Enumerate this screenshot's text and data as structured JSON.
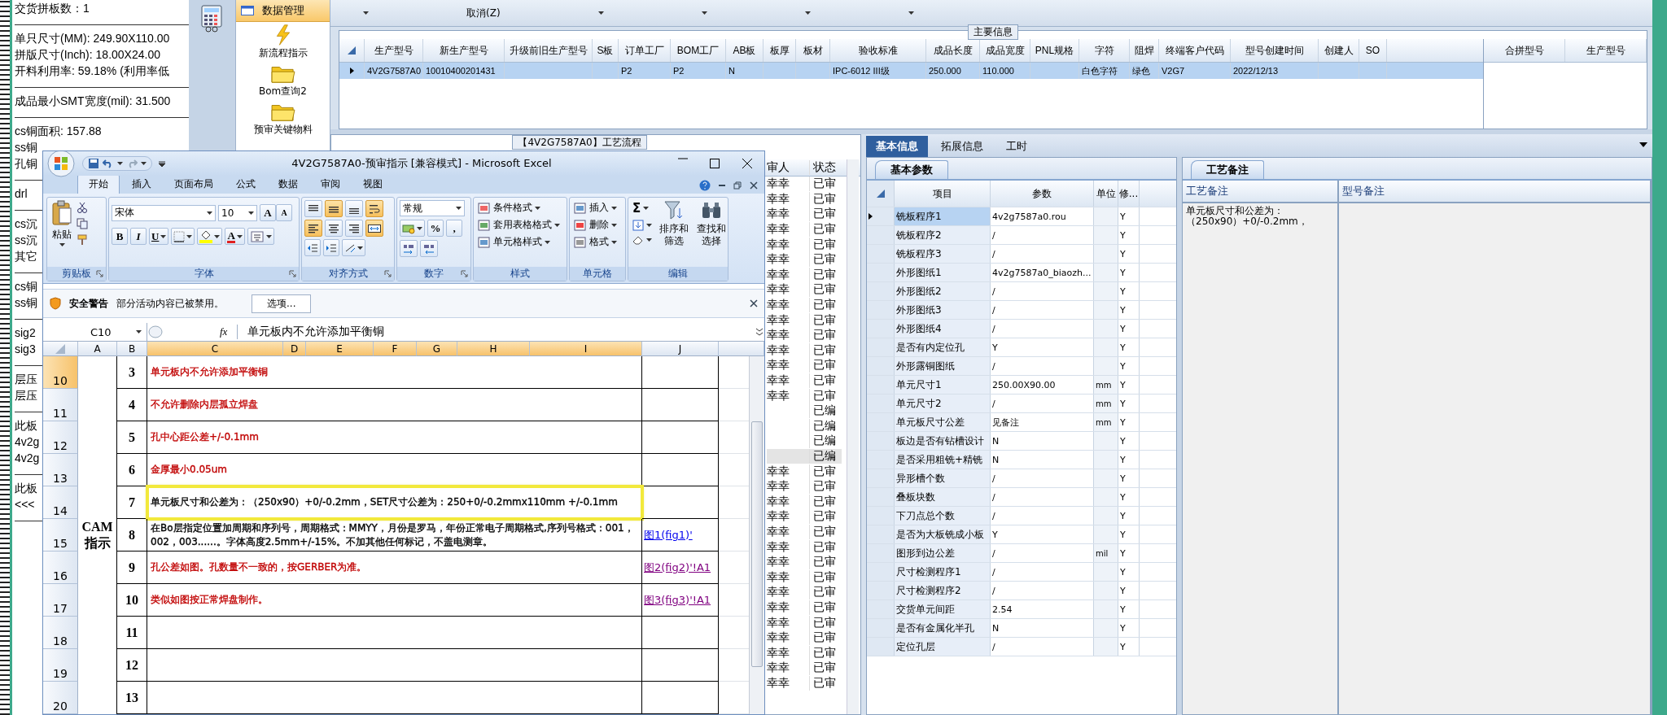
{
  "report_window": {
    "sections": [
      [
        "交货拼板数：1"
      ],
      [
        "单只尺寸(MM): 249.90X110.00",
        "拼版尺寸(Inch): 18.00X24.00",
        "开料利用率: 59.18% (利用率低"
      ],
      [
        "成品最小SMT宽度(mil): 31.500"
      ],
      [
        "cs铜面积: 157.88",
        "ss铜",
        "孔铜"
      ],
      [
        "drl"
      ],
      [
        "cs沉",
        "ss沉",
        "其它"
      ],
      [
        "cs铜",
        "ss铜"
      ],
      [
        "sig2",
        "sig3"
      ],
      [
        "层压",
        "层压"
      ],
      [
        "此板",
        "4v2g",
        "4v2g"
      ],
      [
        "此板",
        "<<<"
      ]
    ]
  },
  "app": {
    "nav": {
      "header": "数据管理",
      "items": [
        {
          "label": "新流程指示",
          "kind": "lightning"
        },
        {
          "label": "Bom查询2",
          "kind": "folder"
        },
        {
          "label": "预审关键物料",
          "kind": "folder"
        }
      ]
    },
    "toolbar": {
      "cancel": "取消(Z)"
    },
    "main_info": {
      "title": "主要信息",
      "columns": [
        "生产型号",
        "新生产型号",
        "升级前旧生产型号",
        "S板",
        "订单工厂",
        "BOM工厂",
        "AB板",
        "板厚",
        "板材",
        "验收标准",
        "成品长度",
        "成品宽度",
        "PNL规格",
        "字符",
        "阻焊",
        "终端客户代码",
        "型号创建时间",
        "创建人",
        "SO"
      ],
      "rows": [
        {
          "selected": true,
          "cells": [
            "4V2G7587A0",
            "10010400201431",
            null,
            null,
            "P2",
            "P2",
            "N",
            null,
            null,
            "IPC-6012 III级",
            "250.000",
            "110.000",
            null,
            "白色字符",
            "绿色",
            "V2G7",
            "2022/12/13",
            null,
            null
          ]
        }
      ],
      "merge_columns": [
        "合拼型号",
        "生产型号"
      ]
    },
    "flow_panel": {
      "title": "【4V2G7587A0】工艺流程",
      "columns": [
        "审人",
        "状态"
      ],
      "rows": [
        {
          "reviewer": "幸幸",
          "status": "已审",
          "selected": false
        },
        {
          "reviewer": "幸幸",
          "status": "已审",
          "selected": false
        },
        {
          "reviewer": "幸幸",
          "status": "已审",
          "selected": false
        },
        {
          "reviewer": "幸幸",
          "status": "已审",
          "selected": false
        },
        {
          "reviewer": "幸幸",
          "status": "已审",
          "selected": false
        },
        {
          "reviewer": "幸幸",
          "status": "已审",
          "selected": false
        },
        {
          "reviewer": "幸幸",
          "status": "已审",
          "selected": false
        },
        {
          "reviewer": "幸幸",
          "status": "已审",
          "selected": false
        },
        {
          "reviewer": "幸幸",
          "status": "已审",
          "selected": false
        },
        {
          "reviewer": "幸幸",
          "status": "已审",
          "selected": false
        },
        {
          "reviewer": "幸幸",
          "status": "已审",
          "selected": false
        },
        {
          "reviewer": "幸幸",
          "status": "已审",
          "selected": false
        },
        {
          "reviewer": "幸幸",
          "status": "已审",
          "selected": false
        },
        {
          "reviewer": "幸幸",
          "status": "已审",
          "selected": false
        },
        {
          "reviewer": "幸幸",
          "status": "已审",
          "selected": false
        },
        {
          "reviewer": null,
          "status": "已编",
          "selected": false
        },
        {
          "reviewer": null,
          "status": "已编",
          "selected": false
        },
        {
          "reviewer": null,
          "status": "已编",
          "selected": false
        },
        {
          "reviewer": null,
          "status": "已编",
          "selected": true
        },
        {
          "reviewer": "幸幸",
          "status": "已审",
          "selected": false
        },
        {
          "reviewer": "幸幸",
          "status": "已审",
          "selected": false
        },
        {
          "reviewer": "幸幸",
          "status": "已审",
          "selected": false
        },
        {
          "reviewer": "幸幸",
          "status": "已审",
          "selected": false
        },
        {
          "reviewer": "幸幸",
          "status": "已审",
          "selected": false
        },
        {
          "reviewer": "幸幸",
          "status": "已审",
          "selected": false
        },
        {
          "reviewer": "幸幸",
          "status": "已审",
          "selected": false
        },
        {
          "reviewer": "幸幸",
          "status": "已审",
          "selected": false
        },
        {
          "reviewer": "幸幸",
          "status": "已审",
          "selected": false
        },
        {
          "reviewer": "幸幸",
          "status": "已审",
          "selected": false
        },
        {
          "reviewer": "幸幸",
          "status": "已审",
          "selected": false
        },
        {
          "reviewer": "幸幸",
          "status": "已审",
          "selected": false
        },
        {
          "reviewer": "幸幸",
          "status": "已审",
          "selected": false
        },
        {
          "reviewer": "幸幸",
          "status": "已审",
          "selected": false
        },
        {
          "reviewer": "幸幸",
          "status": "已审",
          "selected": false
        }
      ]
    },
    "detail_tabs": [
      {
        "label": "基本信息",
        "selected": true
      },
      {
        "label": "拓展信息",
        "selected": false
      },
      {
        "label": "工时",
        "selected": false
      }
    ],
    "params": {
      "tab": "基本参数",
      "columns": [
        "项目",
        "参数",
        "单位",
        "修..."
      ],
      "rows": [
        {
          "item": "铣板程序1",
          "value": "4v2g7587a0.rou",
          "unit": null,
          "flag": "Y",
          "selected": true
        },
        {
          "item": "铣板程序2",
          "value": "/",
          "unit": null,
          "flag": "Y",
          "selected": false
        },
        {
          "item": "铣板程序3",
          "value": "/",
          "unit": null,
          "flag": "Y",
          "selected": false
        },
        {
          "item": "外形图纸1",
          "value": "4v2g7587a0_biaozh...",
          "unit": null,
          "flag": "Y",
          "selected": false
        },
        {
          "item": "外形图纸2",
          "value": "/",
          "unit": null,
          "flag": "Y",
          "selected": false
        },
        {
          "item": "外形图纸3",
          "value": "/",
          "unit": null,
          "flag": "Y",
          "selected": false
        },
        {
          "item": "外形图纸4",
          "value": "/",
          "unit": null,
          "flag": "Y",
          "selected": false
        },
        {
          "item": "是否有内定位孔",
          "value": "Y",
          "unit": null,
          "flag": "Y",
          "selected": false
        },
        {
          "item": "外形露铜图纸",
          "value": "/",
          "unit": null,
          "flag": "Y",
          "selected": false
        },
        {
          "item": "单元尺寸1",
          "value": "250.00X90.00",
          "unit": "mm",
          "flag": "Y",
          "selected": false
        },
        {
          "item": "单元尺寸2",
          "value": "/",
          "unit": "mm",
          "flag": "Y",
          "selected": false
        },
        {
          "item": "单元板尺寸公差",
          "value": "见备注",
          "unit": "mm",
          "flag": "Y",
          "selected": false
        },
        {
          "item": "板边是否有钻槽设计",
          "value": "N",
          "unit": null,
          "flag": "Y",
          "selected": false
        },
        {
          "item": "是否采用粗铣+精铣",
          "value": "N",
          "unit": null,
          "flag": "Y",
          "selected": false
        },
        {
          "item": "异形槽个数",
          "value": "/",
          "unit": null,
          "flag": "Y",
          "selected": false
        },
        {
          "item": "叠板块数",
          "value": "/",
          "unit": null,
          "flag": "Y",
          "selected": false
        },
        {
          "item": "下刀点总个数",
          "value": "/",
          "unit": null,
          "flag": "Y",
          "selected": false
        },
        {
          "item": "是否为大板铣成小板",
          "value": "Y",
          "unit": null,
          "flag": "Y",
          "selected": false
        },
        {
          "item": "图形到边公差",
          "value": "/",
          "unit": "mil",
          "flag": "Y",
          "selected": false
        },
        {
          "item": "尺寸检测程序1",
          "value": "/",
          "unit": null,
          "flag": "Y",
          "selected": false
        },
        {
          "item": "尺寸检测程序2",
          "value": "/",
          "unit": null,
          "flag": "Y",
          "selected": false
        },
        {
          "item": "交货单元间距",
          "value": "2.54",
          "unit": null,
          "flag": "Y",
          "selected": false
        },
        {
          "item": "是否有金属化半孔",
          "value": "N",
          "unit": null,
          "flag": "Y",
          "selected": false
        },
        {
          "item": "定位孔层",
          "value": "/",
          "unit": null,
          "flag": "Y",
          "selected": false
        }
      ]
    },
    "remarks": {
      "tab": "工艺备注",
      "columns": [
        "工艺备注",
        "型号备注"
      ],
      "process_note": "单元板尺寸和公差为：（250x90）+0/-0.2mm，"
    }
  },
  "excel": {
    "title": "4V2G7587A0-预审指示  [兼容模式] - Microsoft Excel",
    "tabs": [
      {
        "label": "开始",
        "selected": true
      },
      {
        "label": "插入",
        "selected": false
      },
      {
        "label": "页面布局",
        "selected": false
      },
      {
        "label": "公式",
        "selected": false
      },
      {
        "label": "数据",
        "selected": false
      },
      {
        "label": "审阅",
        "selected": false
      },
      {
        "label": "视图",
        "selected": false
      }
    ],
    "ribbon": {
      "clipboard": {
        "paste": "粘贴",
        "label": "剪贴板"
      },
      "font": {
        "name": "宋体",
        "size": "10",
        "grow": "A",
        "shrink": "A",
        "bold": "B",
        "italic": "I",
        "underline": "U",
        "color_letter": "A",
        "label": "字体"
      },
      "alignment": {
        "buttons": [
          {
            "kind": "top",
            "on": false
          },
          {
            "kind": "middle",
            "on": true
          },
          {
            "kind": "bottom",
            "on": false
          },
          {
            "kind": "wrap",
            "on": true
          },
          {
            "kind": "left",
            "on": true
          },
          {
            "kind": "center",
            "on": false
          },
          {
            "kind": "right",
            "on": false
          },
          {
            "kind": "merge",
            "on": true
          }
        ],
        "label": "对齐方式"
      },
      "number": {
        "format": "常规",
        "percent": "%",
        "comma": ",",
        "label": "数字"
      },
      "styles": {
        "items": [
          "条件格式",
          "套用表格格式",
          "单元格样式"
        ],
        "label": "样式"
      },
      "cells": {
        "items": [
          "插入",
          "删除",
          "格式"
        ],
        "label": "单元格"
      },
      "editing": {
        "sum": "Σ",
        "sort": "排序和筛选",
        "find": "查找和选择",
        "label": "编辑"
      }
    },
    "security": {
      "label": "安全警告",
      "message": "部分活动内容已被禁用。",
      "button": "选项..."
    },
    "name_box": "C10",
    "fx": "fx",
    "formula": "单元板内不允许添加平衡铜",
    "columns": [
      {
        "label": "A",
        "selected": false
      },
      {
        "label": "B",
        "selected": false
      },
      {
        "label": "C",
        "selected": true
      },
      {
        "label": "D",
        "selected": true
      },
      {
        "label": "E",
        "selected": true
      },
      {
        "label": "F",
        "selected": true
      },
      {
        "label": "G",
        "selected": true
      },
      {
        "label": "H",
        "selected": true
      },
      {
        "label": "I",
        "selected": true
      },
      {
        "label": "J",
        "selected": false
      }
    ],
    "a_cell": "CAM\n指示",
    "rows": [
      {
        "num": "10",
        "selected": true,
        "b": "3",
        "text": "单元板内不允许添加平衡铜",
        "color": "#c00000",
        "highlighted": false
      },
      {
        "num": "11",
        "selected": false,
        "b": "4",
        "text": "不允许删除内层孤立焊盘",
        "color": "#c00000",
        "highlighted": false
      },
      {
        "num": "12",
        "selected": false,
        "b": "5",
        "text": "孔中心距公差+/-0.1mm",
        "color": "#c00000",
        "highlighted": false
      },
      {
        "num": "13",
        "selected": false,
        "b": "6",
        "text": "金厚最小0.05um",
        "color": "#c00000",
        "highlighted": false
      },
      {
        "num": "14",
        "selected": false,
        "b": "7",
        "text": "单元板尺寸和公差为：（250x90）+0/-0.2mm，SET尺寸公差为：250+0/-0.2mmx110mm +/-0.1mm",
        "color": "#000000",
        "highlighted": true
      },
      {
        "num": "15",
        "selected": false,
        "b": "8",
        "text": "在Bo层指定位置加周期和序列号，周期格式：MMYY，月份是罗马，年份正常电子周期格式,序列号格式：001，002，003......。字体高度2.5mm+/-15%。不加其他任何标记，不盖电测章。",
        "color": "#000000",
        "highlighted": false,
        "link": "图1(fig1)'",
        "visited": false
      },
      {
        "num": "16",
        "selected": false,
        "b": "9",
        "text": "孔公差如图。孔数量不一致的，按GERBER为准。",
        "color": "#c00000",
        "highlighted": false,
        "link": "图2(fig2)'!A1",
        "visited": true
      },
      {
        "num": "17",
        "selected": false,
        "b": "10",
        "text": "类似如图按正常焊盘制作。",
        "color": "#c00000",
        "highlighted": false,
        "link": "图3(fig3)'!A1",
        "visited": true
      },
      {
        "num": "18",
        "selected": false,
        "b": "11",
        "highlighted": false
      },
      {
        "num": "19",
        "selected": false,
        "b": "12",
        "highlighted": false
      },
      {
        "num": "20",
        "selected": false,
        "b": "13",
        "highlighted": false
      }
    ]
  }
}
